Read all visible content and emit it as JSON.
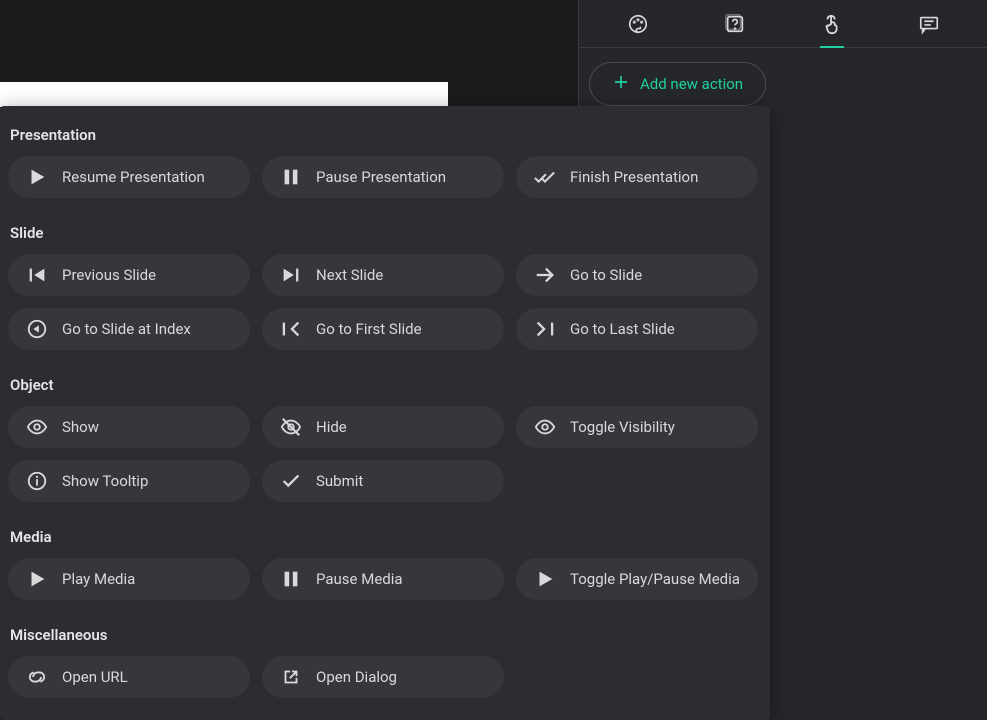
{
  "right_panel": {
    "add_action_label": "Add new action"
  },
  "popup": {
    "sections": [
      {
        "label": "Presentation",
        "rows": [
          [
            {
              "icon": "play",
              "label": "Resume Presentation"
            },
            {
              "icon": "pause",
              "label": "Pause Presentation"
            },
            {
              "icon": "done-all",
              "label": "Finish Presentation"
            }
          ]
        ]
      },
      {
        "label": "Slide",
        "rows": [
          [
            {
              "icon": "skip-prev",
              "label": "Previous Slide"
            },
            {
              "icon": "skip-next",
              "label": "Next Slide"
            },
            {
              "icon": "arrow-right",
              "label": "Go to Slide"
            }
          ],
          [
            {
              "icon": "target-index",
              "label": "Go to Slide at Index"
            },
            {
              "icon": "first-page",
              "label": "Go to First Slide"
            },
            {
              "icon": "last-page",
              "label": "Go to Last Slide"
            }
          ]
        ]
      },
      {
        "label": "Object",
        "rows": [
          [
            {
              "icon": "eye",
              "label": "Show"
            },
            {
              "icon": "eye-off",
              "label": "Hide"
            },
            {
              "icon": "eye",
              "label": "Toggle Visibility"
            }
          ],
          [
            {
              "icon": "info",
              "label": "Show Tooltip"
            },
            {
              "icon": "check",
              "label": "Submit"
            }
          ]
        ]
      },
      {
        "label": "Media",
        "rows": [
          [
            {
              "icon": "play",
              "label": "Play Media"
            },
            {
              "icon": "pause",
              "label": "Pause Media"
            },
            {
              "icon": "play",
              "label": "Toggle Play/Pause Media"
            }
          ]
        ]
      },
      {
        "label": "Miscellaneous",
        "rows": [
          [
            {
              "icon": "link",
              "label": "Open URL"
            },
            {
              "icon": "open-new",
              "label": "Open Dialog"
            }
          ]
        ]
      }
    ]
  }
}
